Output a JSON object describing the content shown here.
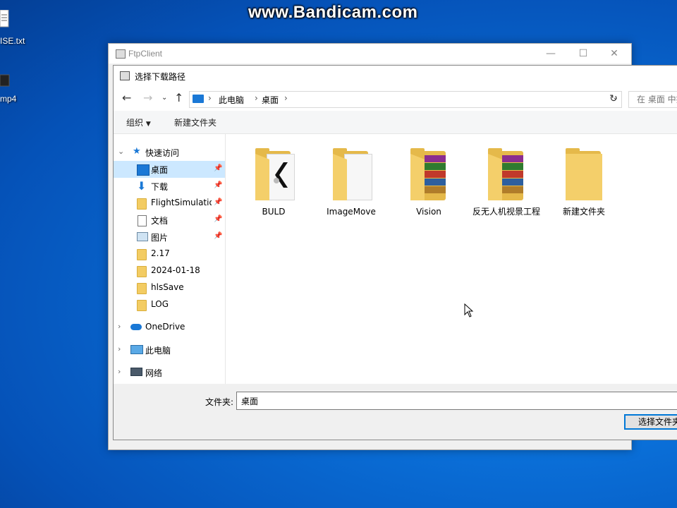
{
  "watermark": "www.Bandicam.com",
  "desktop": {
    "icons": [
      {
        "label": "ISE.txt"
      },
      {
        "label": "mp4"
      }
    ]
  },
  "ftp_window": {
    "title": "FtpClient",
    "buttons": {
      "minimize": "—",
      "maximize": "☐",
      "close": "✕"
    }
  },
  "dialog": {
    "title": "选择下载路径",
    "breadcrumb": [
      "此电脑",
      "桌面"
    ],
    "search_placeholder": "在 桌面 中搜",
    "toolbar": {
      "organize": "组织",
      "new_folder": "新建文件夹"
    },
    "nav_tree": [
      {
        "label": "快速访问",
        "pinned": false
      },
      {
        "label": "桌面",
        "pinned": true
      },
      {
        "label": "下载",
        "pinned": true
      },
      {
        "label": "FlightSimulation",
        "pinned": true
      },
      {
        "label": "文档",
        "pinned": true
      },
      {
        "label": "图片",
        "pinned": true
      },
      {
        "label": "2.17",
        "pinned": false
      },
      {
        "label": "2024-01-18",
        "pinned": false
      },
      {
        "label": "hlsSave",
        "pinned": false
      },
      {
        "label": "LOG",
        "pinned": false
      },
      {
        "label": "OneDrive",
        "pinned": false
      },
      {
        "label": "此电脑",
        "pinned": false
      },
      {
        "label": "网络",
        "pinned": false
      }
    ],
    "files": [
      {
        "name": "BULD",
        "kind": "folder-doc"
      },
      {
        "name": "ImageMove",
        "kind": "folder-empty-doc"
      },
      {
        "name": "Vision",
        "kind": "folder-rar"
      },
      {
        "name": "反无人机视景工程",
        "kind": "folder-rar"
      },
      {
        "name": "新建文件夹",
        "kind": "folder"
      }
    ],
    "footer": {
      "folder_label": "文件夹:",
      "folder_value": "桌面",
      "select_button": "选择文件夹"
    }
  },
  "colors": {
    "desktop_blue": "#0a6fd8",
    "selection": "#cce8ff",
    "folder_yellow": "#f3cc63",
    "accent": "#0078d7"
  }
}
